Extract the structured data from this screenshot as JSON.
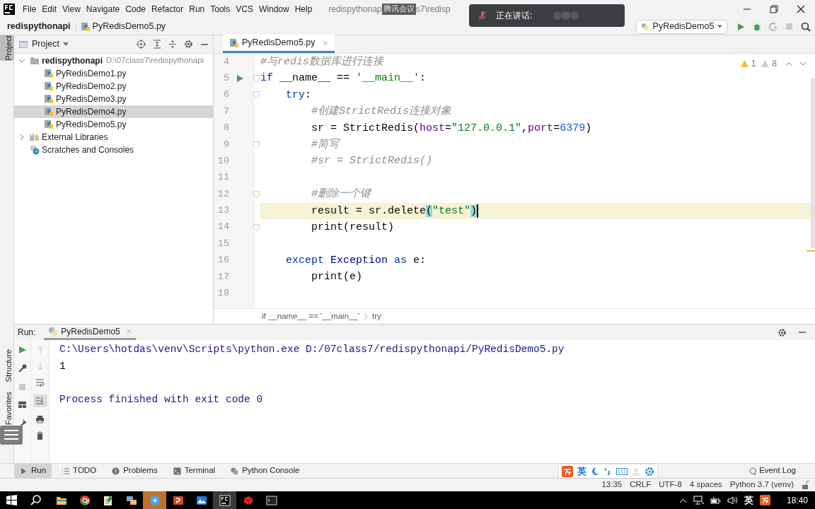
{
  "menu": [
    "File",
    "Edit",
    "View",
    "Navigate",
    "Code",
    "Refactor",
    "Run",
    "Tools",
    "VCS",
    "Window",
    "Help"
  ],
  "window_title": {
    "before": "redispythonap",
    "tag": "腾讯会议",
    "after": "s7\\redisp"
  },
  "speaking_popup": {
    "label": "正在讲话:"
  },
  "nav_bar": {
    "project": "redispythonapi",
    "file": "PyRedisDemo5.py",
    "run_config": "PyRedisDemo5"
  },
  "side_tabs": [
    {
      "label": "Project",
      "selected": true
    },
    {
      "label": "Structure",
      "selected": false
    },
    {
      "label": "Favorites",
      "selected": false
    }
  ],
  "project_panel": {
    "title": "Project",
    "tree": [
      {
        "kind": "folder",
        "label": "redispythonapi",
        "path": "D:\\07class7\\redispythonapi",
        "expanded": true,
        "selected": false,
        "children": [
          {
            "kind": "file",
            "label": "PyRedisDemo1.py",
            "selected": false
          },
          {
            "kind": "file",
            "label": "PyRedisDemo2.py",
            "selected": false
          },
          {
            "kind": "file",
            "label": "PyRedisDemo3.py",
            "selected": false
          },
          {
            "kind": "file",
            "label": "PyRedisDemo4.py",
            "selected": true
          },
          {
            "kind": "file",
            "label": "PyRedisDemo5.py",
            "selected": false
          }
        ]
      },
      {
        "kind": "library",
        "label": "External Libraries",
        "expanded": false,
        "selected": false
      },
      {
        "kind": "scratches",
        "label": "Scratches and Consoles",
        "selected": false
      }
    ]
  },
  "editor_tabs": [
    {
      "label": "PyRedisDemo5.py",
      "selected": true
    }
  ],
  "inspections": {
    "warnings": "1",
    "weak_warnings": "8"
  },
  "code_lines": [
    {
      "number": "4",
      "current": false,
      "run_marker": false,
      "fold": false,
      "tokens": [
        {
          "kind": "comment",
          "text": "#与redis数据库进行连接"
        }
      ]
    },
    {
      "number": "5",
      "current": false,
      "run_marker": true,
      "fold": true,
      "tokens": [
        {
          "kind": "keyword",
          "text": "if"
        },
        {
          "kind": "plain",
          "text": " __name__ == "
        },
        {
          "kind": "string",
          "text": "'__main__'"
        },
        {
          "kind": "plain",
          "text": ":"
        }
      ],
      "children": [
        {
          "number": "6",
          "current": false,
          "run_marker": false,
          "fold": true,
          "tokens": [
            {
              "kind": "keyword",
              "text": "try"
            },
            {
              "kind": "plain",
              "text": ":"
            }
          ],
          "children": [
            {
              "number": "7",
              "current": false,
              "run_marker": false,
              "fold": false,
              "tokens": [
                {
                  "kind": "comment",
                  "text": "#创建StrictRedis连接对象"
                }
              ]
            },
            {
              "number": "8",
              "current": false,
              "run_marker": false,
              "fold": false,
              "tokens": [
                {
                  "kind": "plain",
                  "text": "sr = StrictRedis("
                },
                {
                  "kind": "param",
                  "text": "host"
                },
                {
                  "kind": "plain",
                  "text": "="
                },
                {
                  "kind": "string",
                  "text": "\"127.0.0.1\""
                },
                {
                  "kind": "plain",
                  "text": ","
                },
                {
                  "kind": "param",
                  "text": "port"
                },
                {
                  "kind": "plain",
                  "text": "="
                },
                {
                  "kind": "number",
                  "text": "6379"
                },
                {
                  "kind": "plain",
                  "text": ")"
                }
              ]
            },
            {
              "number": "9",
              "current": false,
              "run_marker": false,
              "fold": true,
              "tokens": [
                {
                  "kind": "comment",
                  "text": "#简写"
                }
              ]
            },
            {
              "number": "10",
              "current": false,
              "run_marker": false,
              "fold": false,
              "tokens": [
                {
                  "kind": "comment",
                  "text": "#sr = StrictRedis()"
                }
              ]
            },
            {
              "number": "11",
              "current": false,
              "run_marker": false,
              "fold": false
            },
            {
              "number": "12",
              "current": false,
              "run_marker": false,
              "fold": true,
              "tokens": [
                {
                  "kind": "comment",
                  "text": "#删除一个键"
                }
              ]
            },
            {
              "number": "13",
              "current": true,
              "run_marker": false,
              "fold": false,
              "tokens": [
                {
                  "kind": "plain",
                  "text": "result = sr.delete"
                },
                {
                  "kind": "brace",
                  "text": "("
                },
                {
                  "kind": "string",
                  "text": "\"test\""
                },
                {
                  "kind": "brace",
                  "text": ")"
                }
              ]
            },
            {
              "number": "14",
              "current": false,
              "run_marker": false,
              "fold": true,
              "tokens": [
                {
                  "kind": "plain",
                  "text": "print(result)"
                }
              ]
            },
            {
              "number": "15",
              "current": false,
              "run_marker": false,
              "fold": false
            }
          ]
        },
        {
          "number": "16",
          "current": false,
          "run_marker": false,
          "fold": false,
          "tokens": [
            {
              "kind": "keyword",
              "text": "except"
            },
            {
              "kind": "builtin",
              "text": " Exception "
            },
            {
              "kind": "keyword",
              "text": "as"
            },
            {
              "kind": "plain",
              "text": " e:"
            }
          ],
          "children": [
            {
              "number": "17",
              "current": false,
              "run_marker": false,
              "fold": false,
              "tokens": [
                {
                  "kind": "plain",
                  "text": "print(e)"
                }
              ]
            },
            {
              "number": "18",
              "current": false,
              "run_marker": false,
              "fold": false
            }
          ]
        }
      ]
    }
  ],
  "breadcrumbs": [
    "if __name__ == '__main__'",
    "try"
  ],
  "run_panel": {
    "label": "Run:",
    "tab": "PyRedisDemo5",
    "output": [
      {
        "kind": "system",
        "text": "C:\\Users\\hotdas\\venv\\Scripts\\python.exe D:/07class7/redispythonapi/PyRedisDemo5.py"
      },
      {
        "kind": "stdout",
        "text": "1"
      },
      {
        "kind": "system",
        "text": "Process finished with exit code 0"
      }
    ]
  },
  "tool_tabs": [
    {
      "label": "Run",
      "selected": true
    },
    {
      "label": "TODO",
      "selected": false
    },
    {
      "label": "Problems",
      "selected": false
    },
    {
      "label": "Terminal",
      "selected": false
    },
    {
      "label": "Python Console",
      "selected": false
    }
  ],
  "event_log": "Event Log",
  "ime_toolbar": {
    "mode": "英"
  },
  "status_bar": [
    "13:35",
    "CRLF",
    "UTF-8",
    "4 spaces",
    "Python 3.7 (venv)"
  ],
  "taskbar": {
    "ime": "英",
    "clock": "18:40"
  }
}
